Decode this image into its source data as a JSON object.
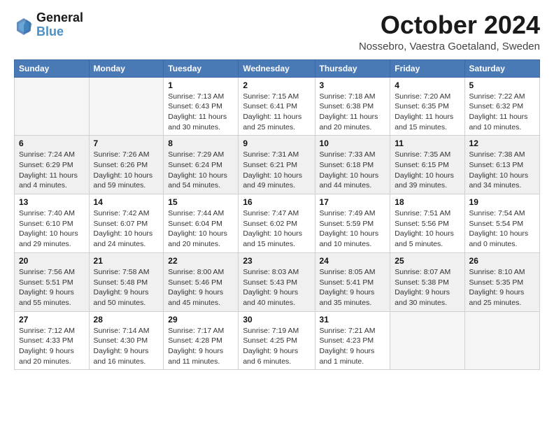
{
  "header": {
    "logo_general": "General",
    "logo_blue": "Blue",
    "title": "October 2024",
    "location": "Nossebro, Vaestra Goetaland, Sweden"
  },
  "calendar": {
    "days_of_week": [
      "Sunday",
      "Monday",
      "Tuesday",
      "Wednesday",
      "Thursday",
      "Friday",
      "Saturday"
    ],
    "weeks": [
      {
        "shade": false,
        "days": [
          {
            "num": "",
            "info": ""
          },
          {
            "num": "",
            "info": ""
          },
          {
            "num": "1",
            "info": "Sunrise: 7:13 AM\nSunset: 6:43 PM\nDaylight: 11 hours\nand 30 minutes."
          },
          {
            "num": "2",
            "info": "Sunrise: 7:15 AM\nSunset: 6:41 PM\nDaylight: 11 hours\nand 25 minutes."
          },
          {
            "num": "3",
            "info": "Sunrise: 7:18 AM\nSunset: 6:38 PM\nDaylight: 11 hours\nand 20 minutes."
          },
          {
            "num": "4",
            "info": "Sunrise: 7:20 AM\nSunset: 6:35 PM\nDaylight: 11 hours\nand 15 minutes."
          },
          {
            "num": "5",
            "info": "Sunrise: 7:22 AM\nSunset: 6:32 PM\nDaylight: 11 hours\nand 10 minutes."
          }
        ]
      },
      {
        "shade": true,
        "days": [
          {
            "num": "6",
            "info": "Sunrise: 7:24 AM\nSunset: 6:29 PM\nDaylight: 11 hours\nand 4 minutes."
          },
          {
            "num": "7",
            "info": "Sunrise: 7:26 AM\nSunset: 6:26 PM\nDaylight: 10 hours\nand 59 minutes."
          },
          {
            "num": "8",
            "info": "Sunrise: 7:29 AM\nSunset: 6:24 PM\nDaylight: 10 hours\nand 54 minutes."
          },
          {
            "num": "9",
            "info": "Sunrise: 7:31 AM\nSunset: 6:21 PM\nDaylight: 10 hours\nand 49 minutes."
          },
          {
            "num": "10",
            "info": "Sunrise: 7:33 AM\nSunset: 6:18 PM\nDaylight: 10 hours\nand 44 minutes."
          },
          {
            "num": "11",
            "info": "Sunrise: 7:35 AM\nSunset: 6:15 PM\nDaylight: 10 hours\nand 39 minutes."
          },
          {
            "num": "12",
            "info": "Sunrise: 7:38 AM\nSunset: 6:13 PM\nDaylight: 10 hours\nand 34 minutes."
          }
        ]
      },
      {
        "shade": false,
        "days": [
          {
            "num": "13",
            "info": "Sunrise: 7:40 AM\nSunset: 6:10 PM\nDaylight: 10 hours\nand 29 minutes."
          },
          {
            "num": "14",
            "info": "Sunrise: 7:42 AM\nSunset: 6:07 PM\nDaylight: 10 hours\nand 24 minutes."
          },
          {
            "num": "15",
            "info": "Sunrise: 7:44 AM\nSunset: 6:04 PM\nDaylight: 10 hours\nand 20 minutes."
          },
          {
            "num": "16",
            "info": "Sunrise: 7:47 AM\nSunset: 6:02 PM\nDaylight: 10 hours\nand 15 minutes."
          },
          {
            "num": "17",
            "info": "Sunrise: 7:49 AM\nSunset: 5:59 PM\nDaylight: 10 hours\nand 10 minutes."
          },
          {
            "num": "18",
            "info": "Sunrise: 7:51 AM\nSunset: 5:56 PM\nDaylight: 10 hours\nand 5 minutes."
          },
          {
            "num": "19",
            "info": "Sunrise: 7:54 AM\nSunset: 5:54 PM\nDaylight: 10 hours\nand 0 minutes."
          }
        ]
      },
      {
        "shade": true,
        "days": [
          {
            "num": "20",
            "info": "Sunrise: 7:56 AM\nSunset: 5:51 PM\nDaylight: 9 hours\nand 55 minutes."
          },
          {
            "num": "21",
            "info": "Sunrise: 7:58 AM\nSunset: 5:48 PM\nDaylight: 9 hours\nand 50 minutes."
          },
          {
            "num": "22",
            "info": "Sunrise: 8:00 AM\nSunset: 5:46 PM\nDaylight: 9 hours\nand 45 minutes."
          },
          {
            "num": "23",
            "info": "Sunrise: 8:03 AM\nSunset: 5:43 PM\nDaylight: 9 hours\nand 40 minutes."
          },
          {
            "num": "24",
            "info": "Sunrise: 8:05 AM\nSunset: 5:41 PM\nDaylight: 9 hours\nand 35 minutes."
          },
          {
            "num": "25",
            "info": "Sunrise: 8:07 AM\nSunset: 5:38 PM\nDaylight: 9 hours\nand 30 minutes."
          },
          {
            "num": "26",
            "info": "Sunrise: 8:10 AM\nSunset: 5:35 PM\nDaylight: 9 hours\nand 25 minutes."
          }
        ]
      },
      {
        "shade": false,
        "days": [
          {
            "num": "27",
            "info": "Sunrise: 7:12 AM\nSunset: 4:33 PM\nDaylight: 9 hours\nand 20 minutes."
          },
          {
            "num": "28",
            "info": "Sunrise: 7:14 AM\nSunset: 4:30 PM\nDaylight: 9 hours\nand 16 minutes."
          },
          {
            "num": "29",
            "info": "Sunrise: 7:17 AM\nSunset: 4:28 PM\nDaylight: 9 hours\nand 11 minutes."
          },
          {
            "num": "30",
            "info": "Sunrise: 7:19 AM\nSunset: 4:25 PM\nDaylight: 9 hours\nand 6 minutes."
          },
          {
            "num": "31",
            "info": "Sunrise: 7:21 AM\nSunset: 4:23 PM\nDaylight: 9 hours\nand 1 minute."
          },
          {
            "num": "",
            "info": ""
          },
          {
            "num": "",
            "info": ""
          }
        ]
      }
    ]
  }
}
